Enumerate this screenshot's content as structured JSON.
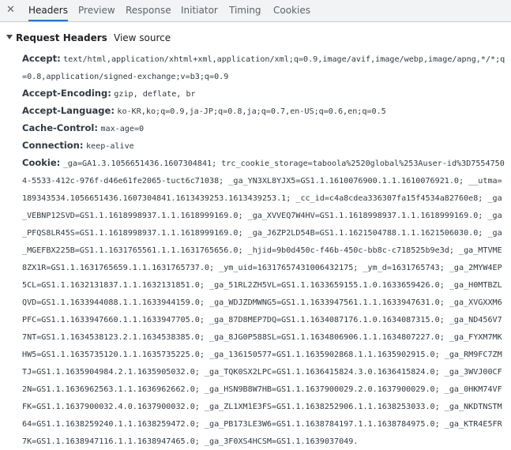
{
  "tabs": [
    {
      "label": "Headers",
      "active": true
    },
    {
      "label": "Preview",
      "active": false
    },
    {
      "label": "Response",
      "active": false
    },
    {
      "label": "Initiator",
      "active": false
    },
    {
      "label": "Timing",
      "active": false
    },
    {
      "label": "Cookies",
      "active": false
    }
  ],
  "close_glyph": "✕",
  "section": {
    "title": "Request Headers",
    "view_source": "View source"
  },
  "headers": [
    {
      "name": "Accept:",
      "value": "text/html,application/xhtml+xml,application/xml;q=0.9,image/avif,image/webp,image/apng,*/*;q=0.8,application/signed-exchange;v=b3;q=0.9"
    },
    {
      "name": "Accept-Encoding:",
      "value": "gzip, deflate, br"
    },
    {
      "name": "Accept-Language:",
      "value": "ko-KR,ko;q=0.9,ja-JP;q=0.8,ja;q=0.7,en-US;q=0.6,en;q=0.5"
    },
    {
      "name": "Cache-Control:",
      "value": "max-age=0"
    },
    {
      "name": "Connection:",
      "value": "keep-alive"
    },
    {
      "name": "Cookie:",
      "value": "_ga=GA1.3.1056651436.1607304841; trc_cookie_storage=taboola%2520global%253Auser-id%3D75547504-5533-412c-976f-d46e61fe2065-tuct6c71038; _ga_YN3XL8YJX5=GS1.1.1610076900.1.1.1610076921.0; __utma=189343534.1056651436.1607304841.1613439253.1613439253.1; _cc_id=c4a8cdea336307fa15f4534a82760e8; _ga_VEBNP12SVD=GS1.1.1618998937.1.1.1618999169.0; _ga_XVVEQ7W4HV=GS1.1.1618998937.1.1.1618999169.0; _ga_PFQS8LR45S=GS1.1.1618998937.1.1.1618999169.0; _ga_J6ZP2LD54B=GS1.1.1621504788.1.1.1621506030.0; _ga_MGEFBX225B=GS1.1.1631765561.1.1.1631765656.0; _hjid=9b0d450c-f46b-450c-bb8c-c718525b9e3d; _ga_MTVME8ZX1R=GS1.1.1631765659.1.1.1631765737.0; _ym_uid=16317657431006432175; _ym_d=1631765743; _ga_2MYW4EP5CL=GS1.1.1632131837.1.1.1632131851.0; _ga_51RL2ZH5VL=GS1.1.1633659155.1.0.1633659426.0; _ga_H0MTBZLQVD=GS1.1.1633944088.1.1.1633944159.0; _ga_WDJZDMWNG5=GS1.1.1633947561.1.1.1633947631.0; _ga_XVGXXM6PFC=GS1.1.1633947660.1.1.1633947705.0; _ga_87D8MEP7DQ=GS1.1.1634087176.1.0.1634087315.0; _ga_ND456V77NT=GS1.1.1634538123.2.1.1634538385.0; _ga_8JG0P588SL=GS1.1.1634806906.1.1.1634807227.0; _ga_FYXM7MKHW5=GS1.1.1635735120.1.1.1635735225.0; _ga_136150577=GS1.1.1635902868.1.1.1635902915.0; _ga_RM9FC7ZMTJ=GS1.1.1635904984.2.1.1635905032.0; _ga_TQK0SX2LPC=GS1.1.1636415824.3.0.1636415824.0; _ga_3WVJ00CF2N=GS1.1.1636962563.1.1.1636962662.0; _ga_HSN9B8W7HB=GS1.1.1637900029.2.0.1637900029.0; _ga_0HKM74VFFK=GS1.1.1637900032.4.0.1637900032.0; _ga_ZL1XM1E3FS=GS1.1.1638252906.1.1.1638253033.0; _ga_NKDTNSTM64=GS1.1.1638259240.1.1.1638259472.0; _ga_PB173LE3W6=GS1.1.1638784197.1.1.1638784975.0; _ga_KTR4E5FR7K=GS1.1.1638947116.1.1.1638947465.0; _ga_3F0XS4HCSM=GS1.1.1639037049."
    }
  ]
}
